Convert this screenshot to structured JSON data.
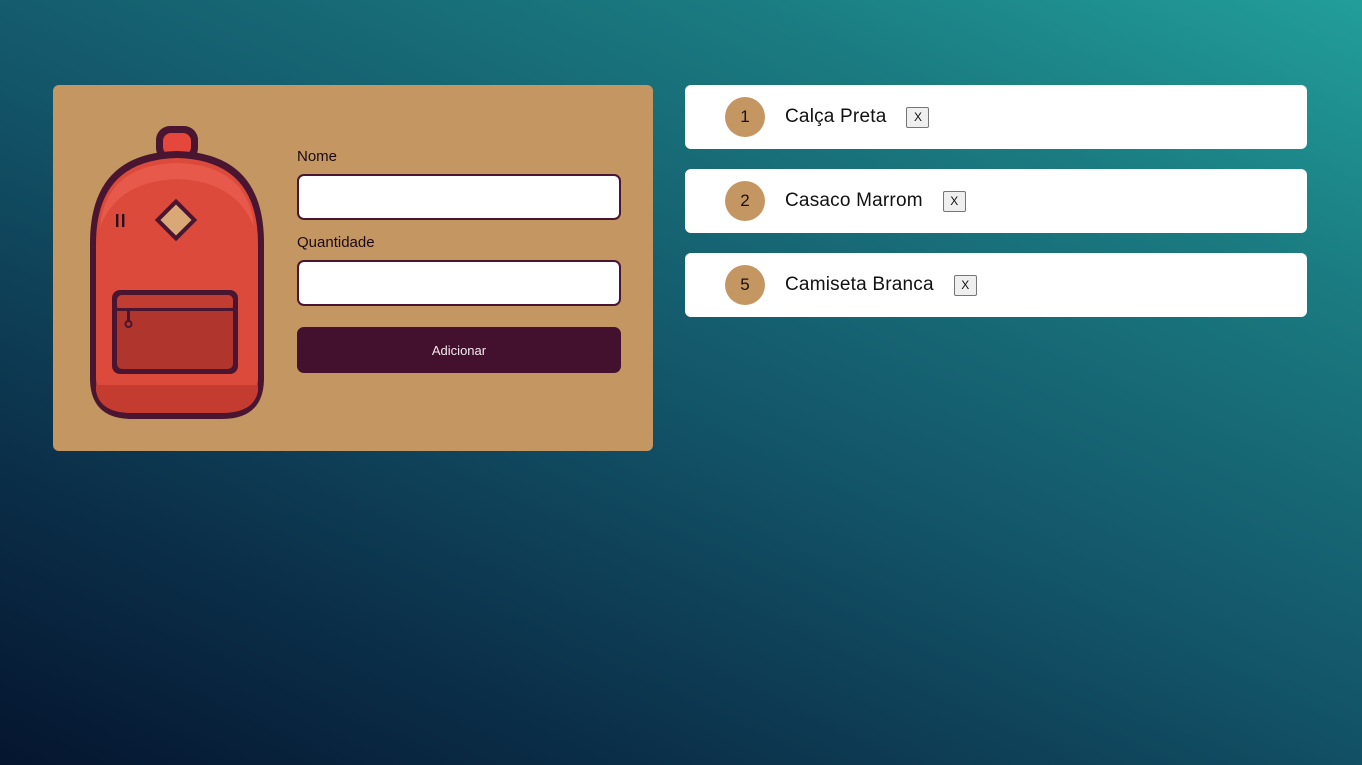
{
  "form": {
    "name_label": "Nome",
    "name_value": "",
    "quantity_label": "Quantidade",
    "quantity_value": "",
    "submit_label": "Adicionar"
  },
  "items": [
    {
      "quantity": "1",
      "name": "Calça Preta",
      "delete_label": "X"
    },
    {
      "quantity": "2",
      "name": "Casaco Marrom",
      "delete_label": "X"
    },
    {
      "quantity": "5",
      "name": "Camiseta Branca",
      "delete_label": "X"
    }
  ],
  "colors": {
    "card": "#c49762",
    "button": "#43112e",
    "backpack_body": "#dc4a3c",
    "backpack_outline": "#4a1530",
    "gradient_top": "#229e9a",
    "gradient_bottom": "#05152f"
  },
  "icons": {
    "illustration": "backpack-icon"
  }
}
